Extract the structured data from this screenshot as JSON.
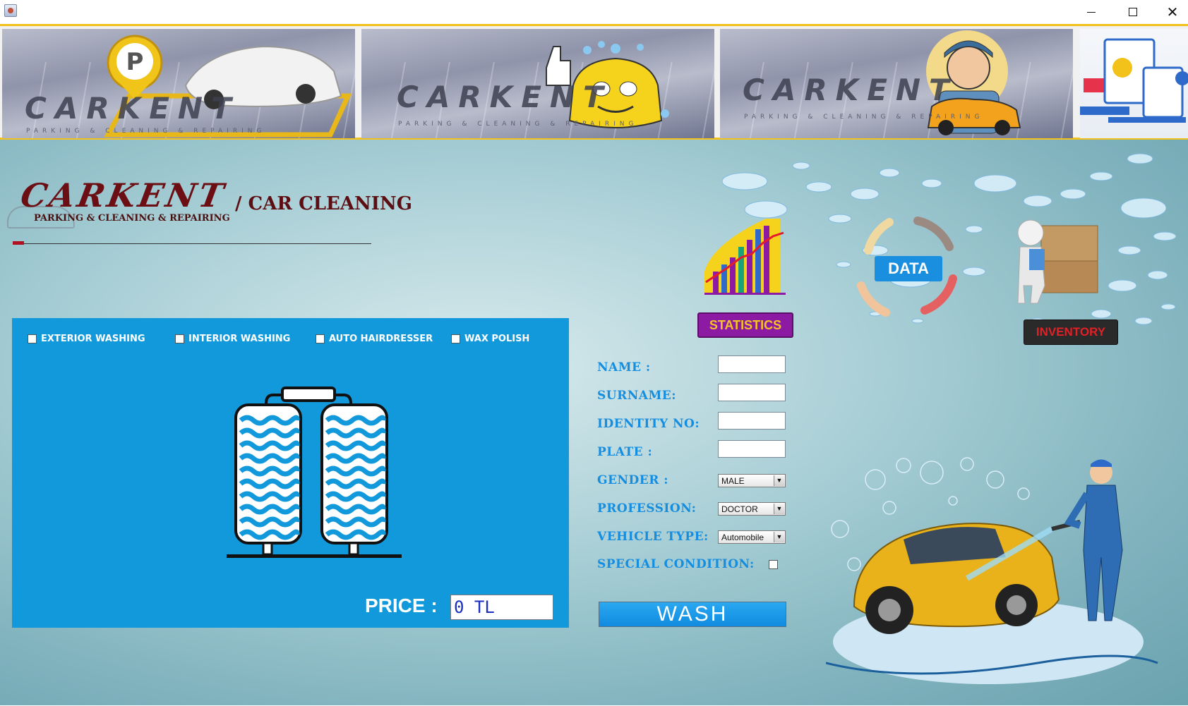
{
  "window": {
    "minimize_glyph": "",
    "maximize_glyph": "",
    "close_glyph": "✕"
  },
  "banner": {
    "brand": "CARKENT",
    "subtitle": "PARKING & CLEANING & REPAIRING"
  },
  "logo": {
    "main": "CARKENT",
    "suffix": "/ CAR CLEANING",
    "subtitle": "PARKING & CLEANING & REPAIRING"
  },
  "services": [
    {
      "label": "EXTERIOR WASHING",
      "checked": false
    },
    {
      "label": "INTERIOR WASHING",
      "checked": false
    },
    {
      "label": "AUTO HAIRDRESSER",
      "checked": false
    },
    {
      "label": "WAX POLISH",
      "checked": false
    }
  ],
  "price": {
    "label": "PRICE :",
    "value": "0 TL"
  },
  "form": {
    "name_label": "NAME :",
    "surname_label": "SURNAME:",
    "identity_label": "IDENTITY NO:",
    "plate_label": "PLATE :",
    "gender_label": "GENDER :",
    "gender_value": "MALE",
    "profession_label": "PROFESSION:",
    "profession_value": "DOCTOR",
    "vehicle_label": "VEHICLE TYPE:",
    "vehicle_value": "Automobile",
    "special_label": "SPECIAL CONDITION:",
    "name_value": "",
    "surname_value": "",
    "identity_value": "",
    "plate_value": ""
  },
  "buttons": {
    "wash": "WASH",
    "statistics": "STATISTICS",
    "data": "DATA",
    "inventory": "INVENTORY"
  },
  "icons": [
    "app-icon",
    "minimize-icon",
    "maximize-icon",
    "close-icon",
    "car-wash-brushes-icon",
    "statistics-chart-icon",
    "inventory-boxes-icon",
    "parking-pin-icon"
  ],
  "colors": {
    "panel_blue": "#1199db",
    "label_blue": "#168ee0",
    "stats_purple": "#8d1aa3",
    "stats_text": "#f3c226",
    "inventory_red": "#e41f26",
    "banner_gold": "#f2c21b",
    "logo_red": "#6b0f14"
  }
}
